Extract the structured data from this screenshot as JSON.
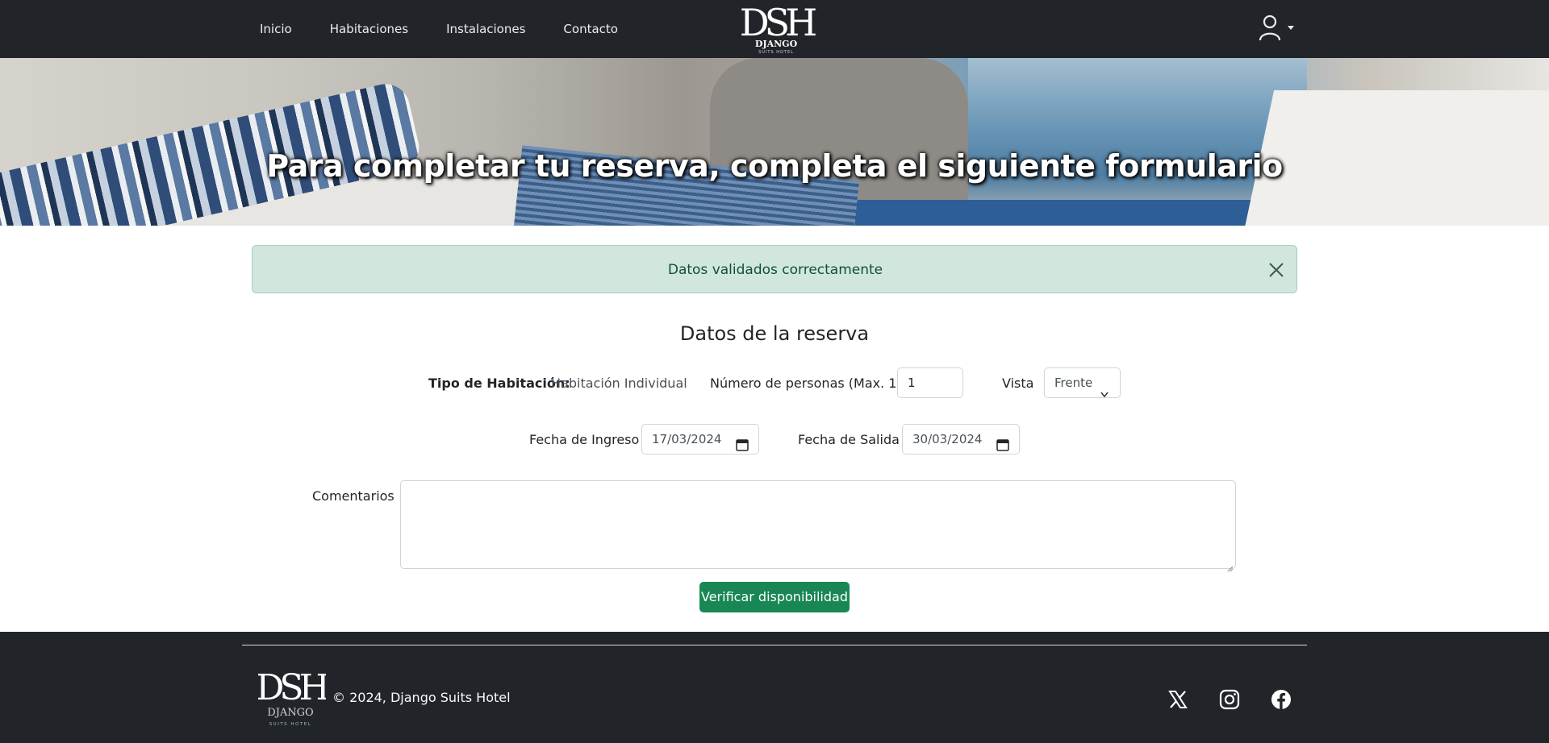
{
  "navbar": {
    "links": [
      {
        "label": "Inicio"
      },
      {
        "label": "Habitaciones"
      },
      {
        "label": "Instalaciones"
      },
      {
        "label": "Contacto"
      }
    ],
    "brand": {
      "monogram": "DSH",
      "name": "DJANGO",
      "tagline": "SUITS HOTEL"
    },
    "user_icon": "user-icon"
  },
  "hero": {
    "title": "Para completar tu reserva, completa el siguiente formulario"
  },
  "alert": {
    "message": "Datos validados correctamente",
    "close_icon": "close-icon",
    "color": "#d1e7dd"
  },
  "form": {
    "title": "Datos de la reserva",
    "room_type_label": "Tipo de Habitación:",
    "room_type_value": "Habitación Individual",
    "people_label": "Número de personas (Max. 1):",
    "people_value": "1",
    "view_label": "Vista",
    "view_value": "Frente",
    "checkin_label": "Fecha de Ingreso",
    "checkin_value": "17/03/2024",
    "checkout_label": "Fecha de Salida",
    "checkout_value": "30/03/2024",
    "comments_label": "Comentarios",
    "comments_value": "",
    "submit_label": "Verificar disponibilidad",
    "submit_color": "#198754"
  },
  "footer": {
    "copyright": "© 2024, Django Suits Hotel",
    "social": [
      {
        "icon": "x-twitter-icon"
      },
      {
        "icon": "instagram-icon"
      },
      {
        "icon": "facebook-icon"
      }
    ]
  }
}
